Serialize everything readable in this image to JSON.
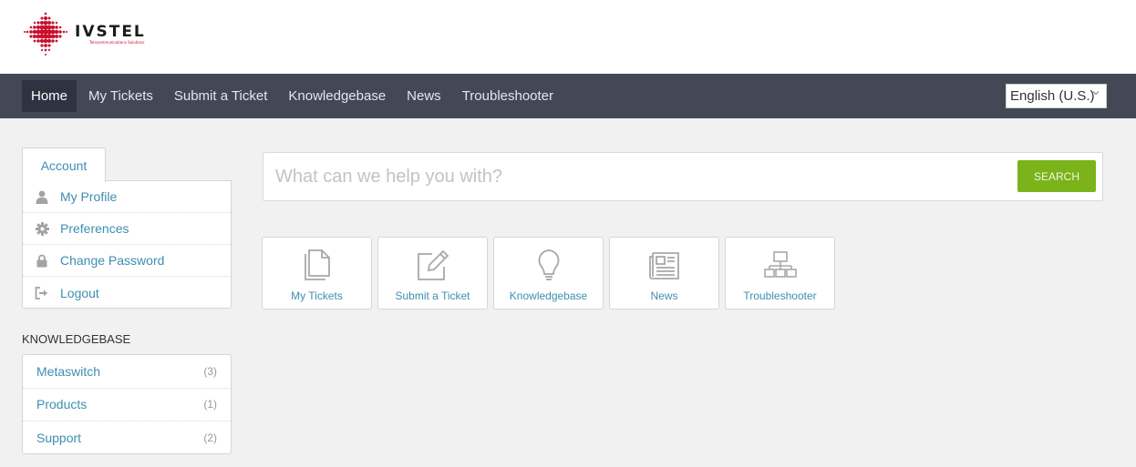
{
  "header": {
    "logo": {
      "name": "IVSTEL",
      "tagline": "Telecommunications Solutions",
      "brand_color": "#c8102e"
    }
  },
  "navbar": {
    "items": [
      {
        "label": "Home",
        "active": true
      },
      {
        "label": "My Tickets",
        "active": false
      },
      {
        "label": "Submit a Ticket",
        "active": false
      },
      {
        "label": "Knowledgebase",
        "active": false
      },
      {
        "label": "News",
        "active": false
      },
      {
        "label": "Troubleshooter",
        "active": false
      }
    ],
    "language": {
      "selected": "English (U.S.)",
      "icon": "chevron-down-icon"
    },
    "background": "#434857"
  },
  "sidebar": {
    "account": {
      "tab_label": "Account",
      "items": [
        {
          "label": "My Profile",
          "icon": "user-icon"
        },
        {
          "label": "Preferences",
          "icon": "gear-icon"
        },
        {
          "label": "Change Password",
          "icon": "lock-icon"
        },
        {
          "label": "Logout",
          "icon": "logout-icon"
        }
      ]
    },
    "knowledgebase": {
      "heading": "KNOWLEDGEBASE",
      "items": [
        {
          "label": "Metaswitch",
          "count": "(3)"
        },
        {
          "label": "Products",
          "count": "(1)"
        },
        {
          "label": "Support",
          "count": "(2)"
        }
      ]
    }
  },
  "search": {
    "placeholder": "What can we help you with?",
    "value": "",
    "button_label": "SEARCH",
    "button_color": "#7bb31a"
  },
  "cards": [
    {
      "label": "My Tickets",
      "icon": "documents-icon"
    },
    {
      "label": "Submit a Ticket",
      "icon": "edit-icon"
    },
    {
      "label": "Knowledgebase",
      "icon": "lightbulb-icon"
    },
    {
      "label": "News",
      "icon": "newspaper-icon"
    },
    {
      "label": "Troubleshooter",
      "icon": "sitemap-icon"
    }
  ],
  "link_color": "#3d8fb0"
}
